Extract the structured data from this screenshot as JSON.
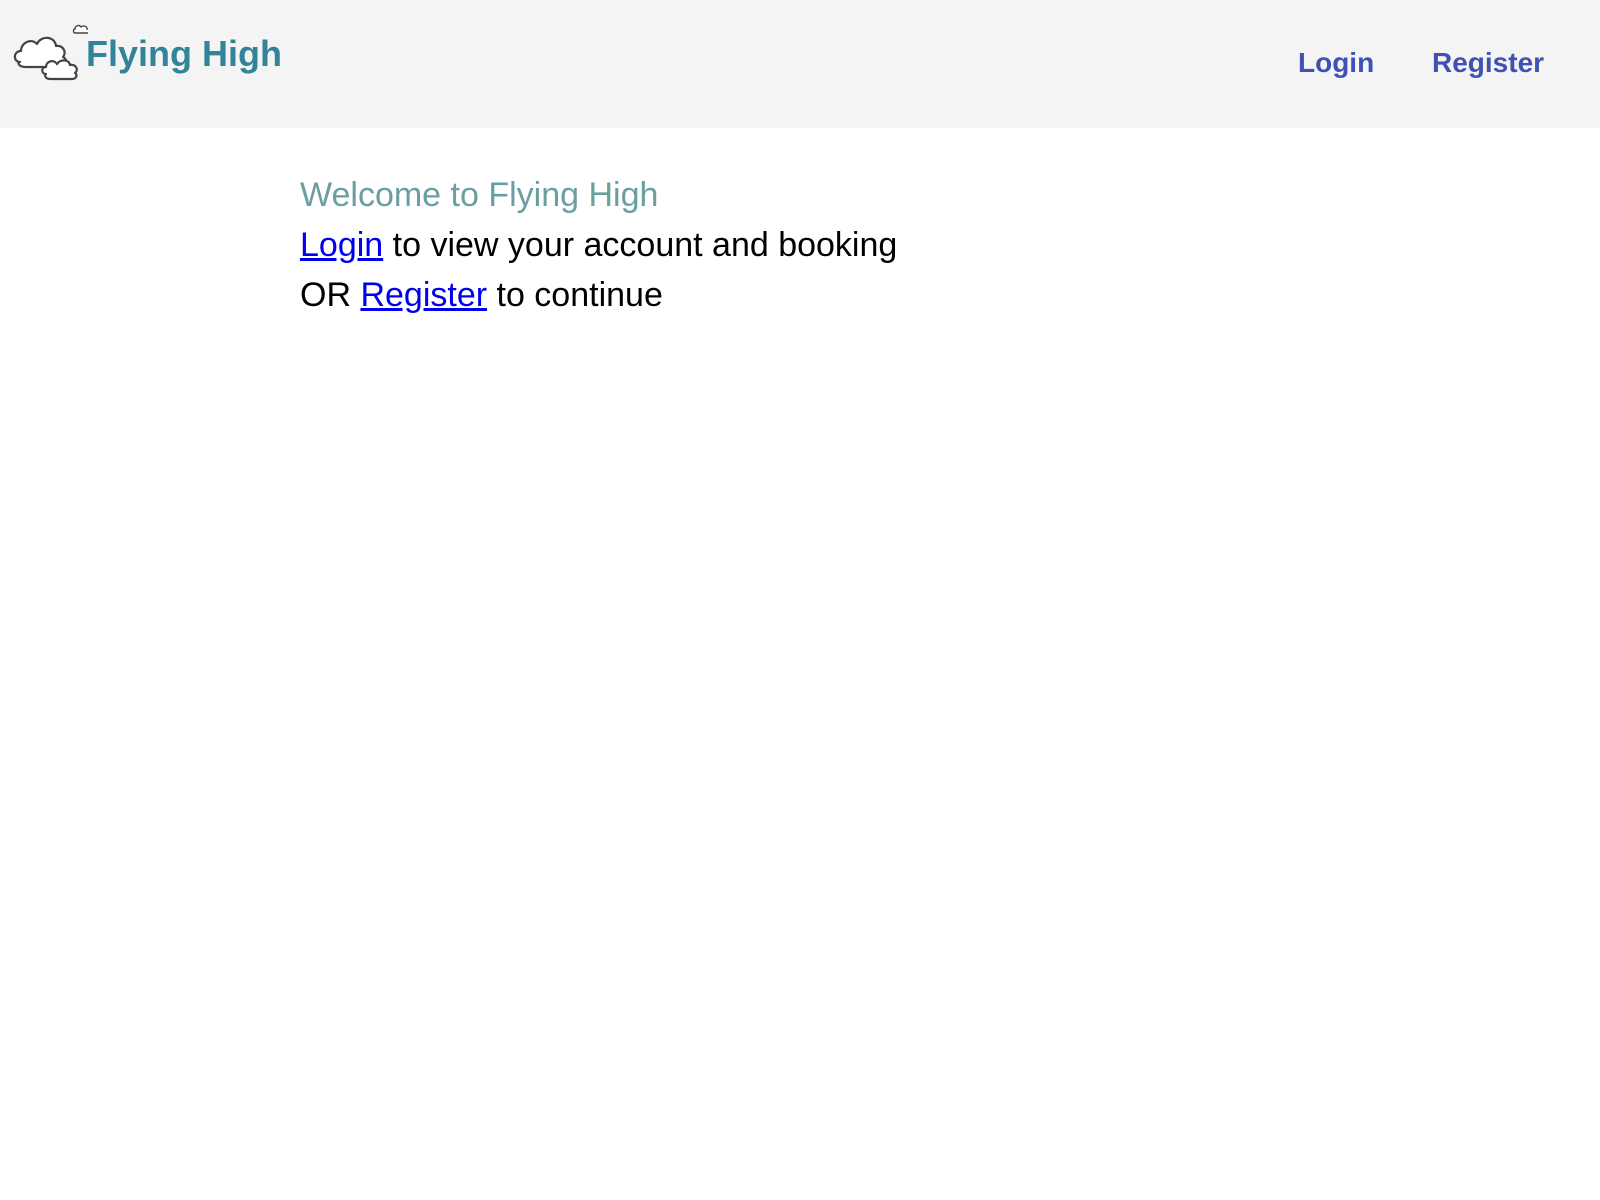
{
  "navbar": {
    "brand": {
      "name": "Flying High",
      "icon": "clouds-logo-icon"
    },
    "links": {
      "login": "Login",
      "register": "Register"
    },
    "background_color": "#f4f4f4",
    "link_color": "#3f51b5"
  },
  "main": {
    "welcome": "Welcome to Flying High",
    "line1": {
      "link": "Login",
      "text": " to view your account and booking"
    },
    "line2": {
      "prefix": "OR ",
      "link": "Register",
      "text": " to continue"
    },
    "welcome_color": "#6a9ea0",
    "link_color": "#0000ee"
  }
}
